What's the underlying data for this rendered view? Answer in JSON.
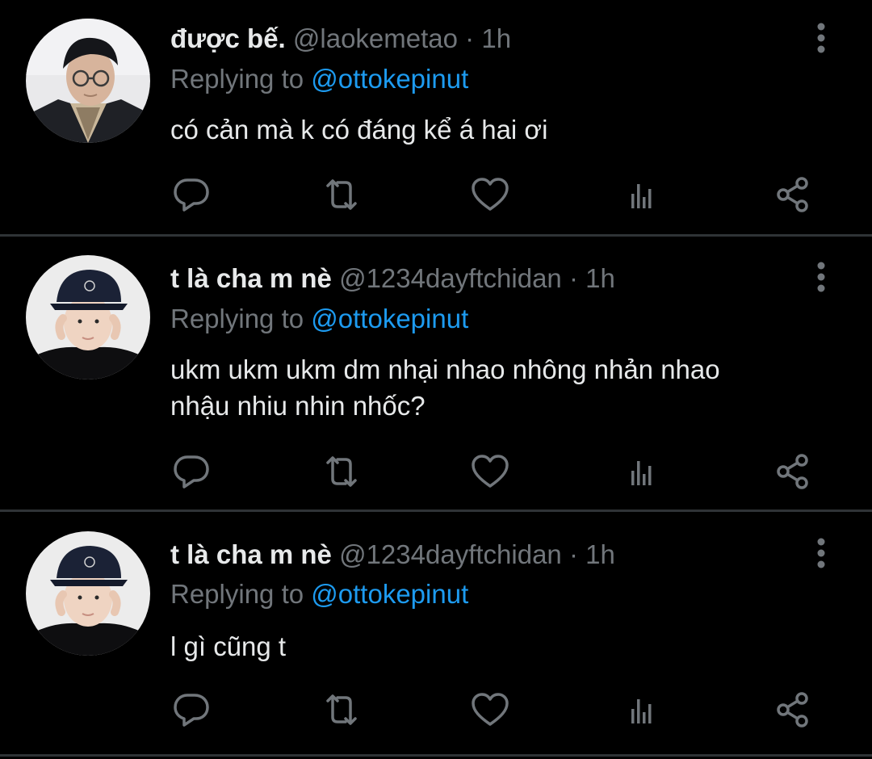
{
  "colors": {
    "background": "#000000",
    "primary_text": "#e7e9ea",
    "secondary_text": "#71767b",
    "accent": "#1d9bf0",
    "divider": "#2f3336",
    "icon": "#71767b"
  },
  "tweets": [
    {
      "display_name": "được bế.",
      "handle": "@laokemetao",
      "separator": "·",
      "time": "1h",
      "replying_prefix": "Replying to",
      "replying_to": "@ottokepinut",
      "text": "có cản mà k có đáng kể á hai ơi",
      "avatar_icon": "person-glasses-avatar",
      "more_icon": "more-vertical-icon"
    },
    {
      "display_name": "t là cha m nè",
      "handle": "@1234dayftchidan",
      "separator": "·",
      "time": "1h",
      "replying_prefix": "Replying to",
      "replying_to": "@ottokepinut",
      "text": "ukm ukm ukm dm nhại nhao nhông nhản nhao\nnhậu nhiu nhin nhốc?",
      "avatar_icon": "person-cap-avatar",
      "more_icon": "more-vertical-icon"
    },
    {
      "display_name": "t là cha m nè",
      "handle": "@1234dayftchidan",
      "separator": "·",
      "time": "1h",
      "replying_prefix": "Replying to",
      "replying_to": "@ottokepinut",
      "text": "l gì cũng t",
      "avatar_icon": "person-cap-avatar",
      "more_icon": "more-vertical-icon"
    }
  ],
  "action_icons": [
    "reply-icon",
    "retweet-icon",
    "like-icon",
    "analytics-icon",
    "share-icon"
  ]
}
